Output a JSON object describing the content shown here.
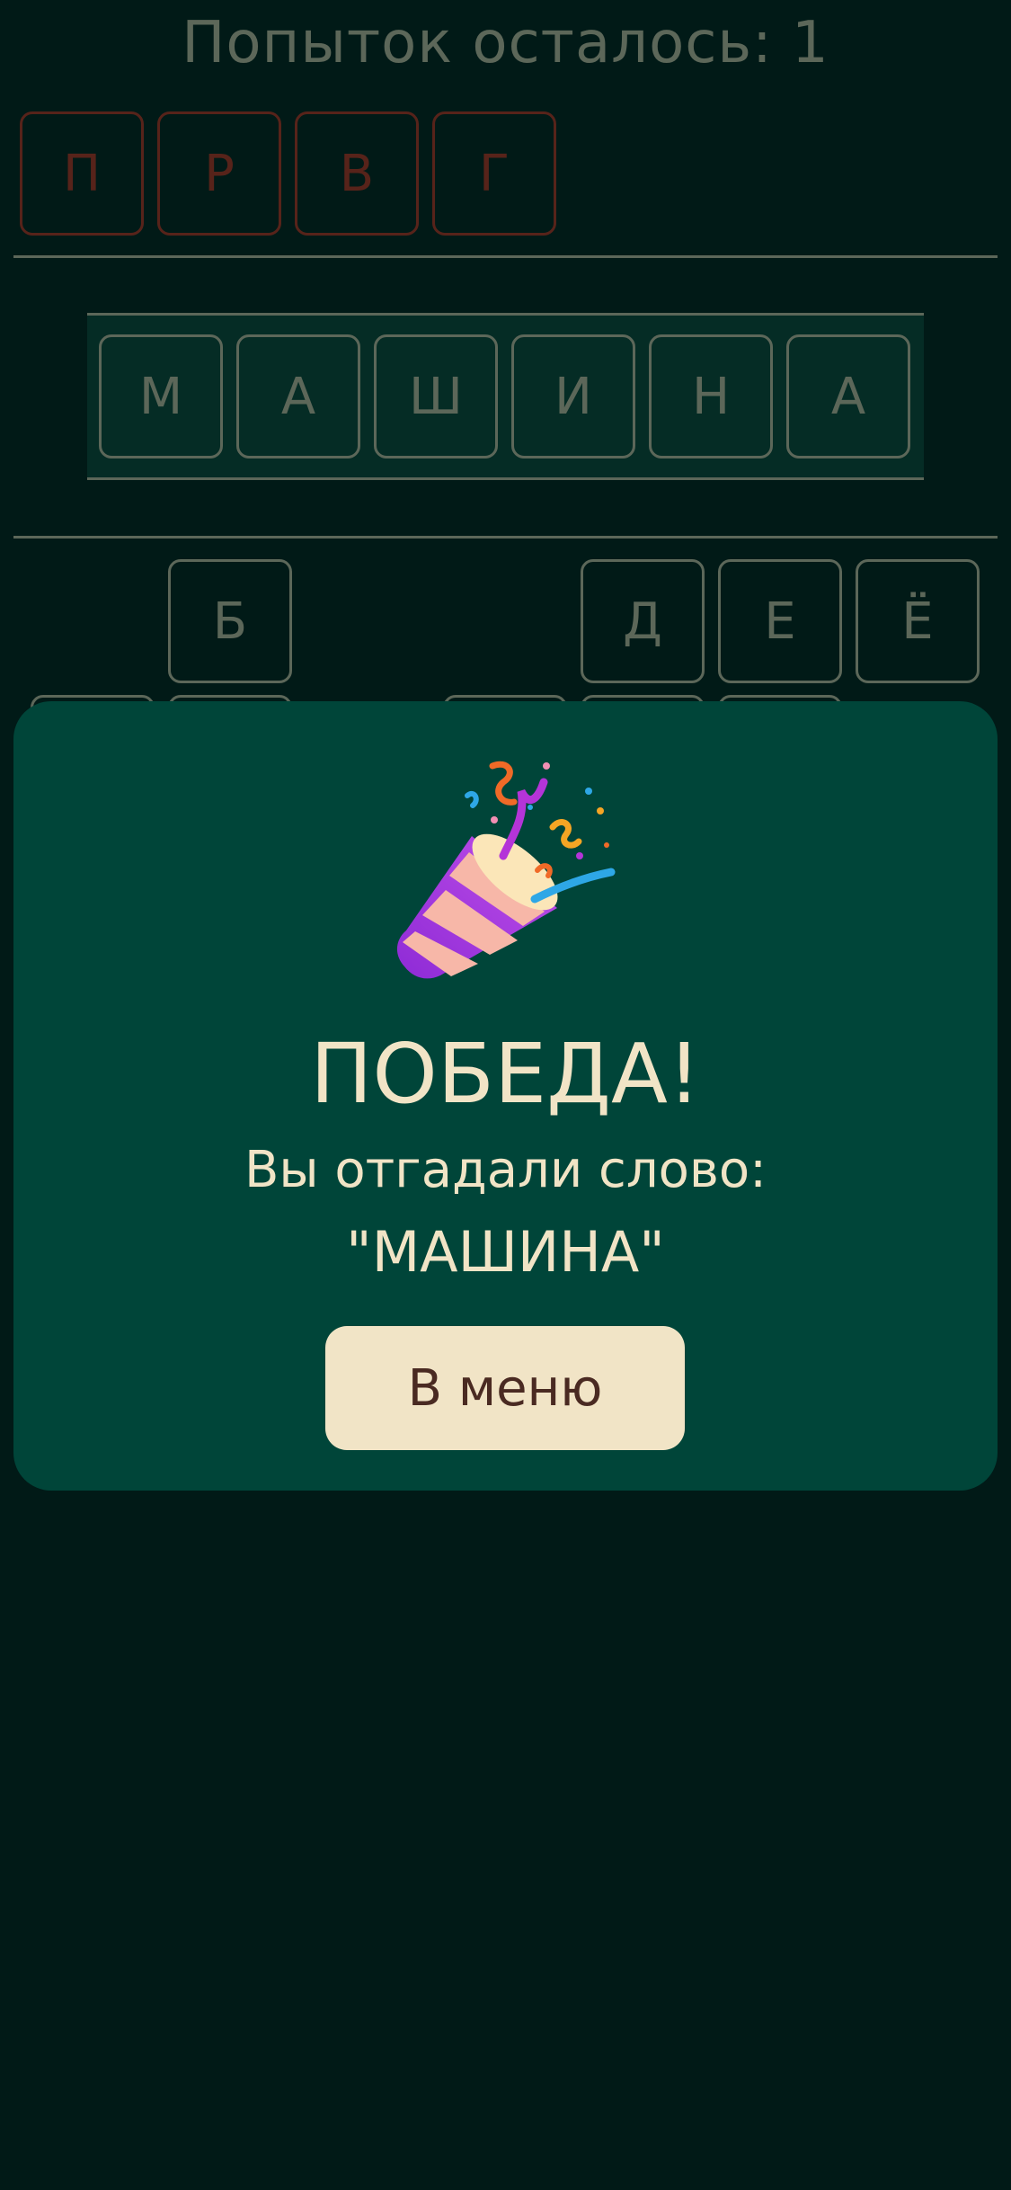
{
  "header": {
    "attempts_text": "Попыток осталось: 1"
  },
  "wrong_letters": [
    "П",
    "Р",
    "В",
    "Г"
  ],
  "word_letters": [
    "М",
    "А",
    "Ш",
    "И",
    "Н",
    "А"
  ],
  "keyboard_row_1": [
    "Б",
    "Д",
    "Е",
    "Ё"
  ],
  "modal": {
    "icon": "party-popper-icon",
    "title": "ПОБЕДА!",
    "subtitle": "Вы отгадали слово:",
    "word": "\"МАШИНА\"",
    "menu_button_label": "В меню"
  },
  "colors": {
    "background": "#011a17",
    "modal_background": "#004539",
    "accent_cream": "#f1e4c6",
    "wrong_red": "#e3331f",
    "button_text": "#4a2a22"
  }
}
